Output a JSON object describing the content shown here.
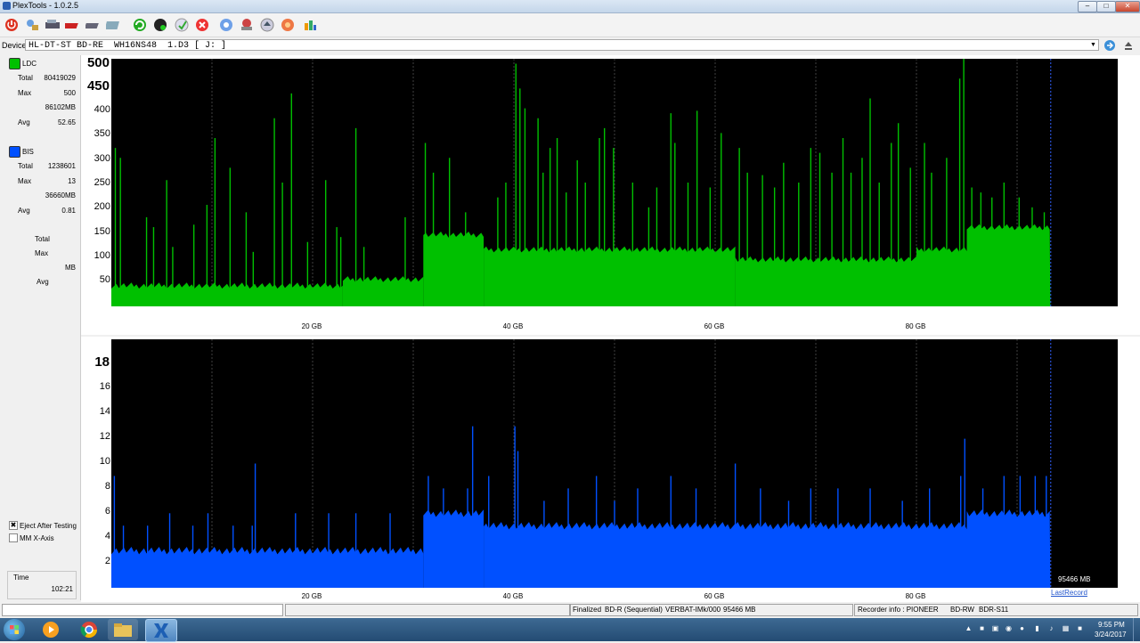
{
  "window": {
    "title": "PlexTools - 1.0.2.5"
  },
  "toolbar": {
    "icons": [
      "power-icon",
      "drive-info-icon",
      "drive-config-icon",
      "disc-write-icon",
      "disc-read-icon",
      "media-info-icon",
      "refresh-icon",
      "disc-quality-icon",
      "clean-icon",
      "stop-icon",
      "q-check-icon",
      "disc-copy-icon",
      "eject-icon",
      "settings-icon",
      "about-icon"
    ]
  },
  "device": {
    "label": "Device:",
    "value": "HL-DT-ST BD-RE  WH16NS48  1.D3 [ J: ]"
  },
  "left_panel": {
    "ldc": {
      "name": "LDC",
      "color": "#00c000",
      "total_label": "Total",
      "total": "80419029",
      "max_label": "Max",
      "max": "500",
      "max_pos": "86102MB",
      "avg_label": "Avg",
      "avg": "52.65"
    },
    "bis": {
      "name": "BIS",
      "color": "#0050ff",
      "total_label": "Total",
      "total": "1238601",
      "max_label": "Max",
      "max": "13",
      "max_pos": "36660MB",
      "avg_label": "Avg",
      "avg": "0.81"
    },
    "third": {
      "total_label": "Total",
      "max_label": "Max",
      "mb_label": "MB",
      "avg_label": "Avg"
    },
    "eject_after_testing": {
      "label": "Eject After Testing",
      "checked": true
    },
    "mm_x_axis": {
      "label": "MM X-Axis",
      "checked": false
    },
    "time": {
      "label": "Time",
      "value": "102:21"
    }
  },
  "chart_data": [
    {
      "type": "area",
      "series": [
        {
          "name": "LDC",
          "color": "#00c000"
        }
      ],
      "x_unit": "GB",
      "xlim": [
        0,
        100
      ],
      "data_end_gb": 93.3,
      "ylim": [
        0,
        500
      ],
      "y_ticks": [
        "500",
        "450",
        "400",
        "350",
        "300",
        "250",
        "200",
        "150",
        "100",
        "50"
      ],
      "x_ticks": [
        "20 GB",
        "40 GB",
        "60 GB",
        "80 GB"
      ],
      "baseline_segments": [
        {
          "from": 0,
          "to": 23,
          "level": 42
        },
        {
          "from": 23,
          "to": 31,
          "level": 55
        },
        {
          "from": 31,
          "to": 37,
          "level": 145
        },
        {
          "from": 37,
          "to": 62,
          "level": 115
        },
        {
          "from": 62,
          "to": 80,
          "level": 95
        },
        {
          "from": 80,
          "to": 85,
          "level": 115
        },
        {
          "from": 85,
          "to": 93.3,
          "level": 160
        }
      ],
      "spikes": [
        {
          "x": 0.4,
          "v": 320
        },
        {
          "x": 0.9,
          "v": 300
        },
        {
          "x": 3.5,
          "v": 180
        },
        {
          "x": 4.2,
          "v": 160
        },
        {
          "x": 5.5,
          "v": 255
        },
        {
          "x": 6.1,
          "v": 120
        },
        {
          "x": 8.2,
          "v": 165
        },
        {
          "x": 9.5,
          "v": 205
        },
        {
          "x": 10.3,
          "v": 340
        },
        {
          "x": 11.8,
          "v": 280
        },
        {
          "x": 13.4,
          "v": 190
        },
        {
          "x": 14.1,
          "v": 110
        },
        {
          "x": 16.2,
          "v": 380
        },
        {
          "x": 17.0,
          "v": 250
        },
        {
          "x": 17.9,
          "v": 430
        },
        {
          "x": 19.5,
          "v": 130
        },
        {
          "x": 21.3,
          "v": 255
        },
        {
          "x": 22.4,
          "v": 160
        },
        {
          "x": 22.8,
          "v": 140
        },
        {
          "x": 24.3,
          "v": 360
        },
        {
          "x": 25.1,
          "v": 120
        },
        {
          "x": 29.2,
          "v": 180
        },
        {
          "x": 31.2,
          "v": 330
        },
        {
          "x": 32.0,
          "v": 270
        },
        {
          "x": 33.6,
          "v": 300
        },
        {
          "x": 35.2,
          "v": 190
        },
        {
          "x": 38.4,
          "v": 220
        },
        {
          "x": 39.2,
          "v": 250
        },
        {
          "x": 40.2,
          "v": 490
        },
        {
          "x": 40.6,
          "v": 440
        },
        {
          "x": 41.1,
          "v": 400
        },
        {
          "x": 42.4,
          "v": 380
        },
        {
          "x": 42.9,
          "v": 270
        },
        {
          "x": 43.6,
          "v": 320
        },
        {
          "x": 44.3,
          "v": 340
        },
        {
          "x": 45.2,
          "v": 230
        },
        {
          "x": 46.3,
          "v": 295
        },
        {
          "x": 47.1,
          "v": 250
        },
        {
          "x": 48.5,
          "v": 340
        },
        {
          "x": 49.0,
          "v": 360
        },
        {
          "x": 49.9,
          "v": 320
        },
        {
          "x": 51.8,
          "v": 250
        },
        {
          "x": 53.4,
          "v": 200
        },
        {
          "x": 54.2,
          "v": 240
        },
        {
          "x": 55.6,
          "v": 390
        },
        {
          "x": 56.0,
          "v": 330
        },
        {
          "x": 57.3,
          "v": 250
        },
        {
          "x": 58.2,
          "v": 395
        },
        {
          "x": 59.5,
          "v": 240
        },
        {
          "x": 60.6,
          "v": 350
        },
        {
          "x": 62.4,
          "v": 320
        },
        {
          "x": 63.2,
          "v": 270
        },
        {
          "x": 64.7,
          "v": 265
        },
        {
          "x": 65.9,
          "v": 240
        },
        {
          "x": 66.8,
          "v": 290
        },
        {
          "x": 68.3,
          "v": 250
        },
        {
          "x": 69.5,
          "v": 320
        },
        {
          "x": 70.4,
          "v": 310
        },
        {
          "x": 71.6,
          "v": 270
        },
        {
          "x": 72.7,
          "v": 340
        },
        {
          "x": 73.5,
          "v": 270
        },
        {
          "x": 74.6,
          "v": 300
        },
        {
          "x": 75.4,
          "v": 420
        },
        {
          "x": 76.3,
          "v": 250
        },
        {
          "x": 77.5,
          "v": 330
        },
        {
          "x": 78.2,
          "v": 370
        },
        {
          "x": 79.4,
          "v": 280
        },
        {
          "x": 80.8,
          "v": 330
        },
        {
          "x": 81.5,
          "v": 270
        },
        {
          "x": 83.0,
          "v": 300
        },
        {
          "x": 84.3,
          "v": 460
        },
        {
          "x": 84.7,
          "v": 500
        },
        {
          "x": 85.5,
          "v": 240
        },
        {
          "x": 86.4,
          "v": 230
        },
        {
          "x": 87.5,
          "v": 220
        },
        {
          "x": 88.7,
          "v": 250
        },
        {
          "x": 90.2,
          "v": 220
        },
        {
          "x": 91.5,
          "v": 200
        },
        {
          "x": 92.7,
          "v": 190
        }
      ]
    },
    {
      "type": "bar",
      "series": [
        {
          "name": "BIS",
          "color": "#0050ff"
        }
      ],
      "x_unit": "GB",
      "xlim": [
        0,
        100
      ],
      "data_end_gb": 93.3,
      "ylim": [
        0,
        20
      ],
      "y_ticks": [
        "18",
        "16",
        "14",
        "12",
        "10",
        "8",
        "6",
        "4",
        "2"
      ],
      "x_ticks": [
        "20 GB",
        "40 GB",
        "60 GB",
        "80 GB"
      ],
      "baseline_segments": [
        {
          "from": 0,
          "to": 31,
          "level": 3
        },
        {
          "from": 31,
          "to": 37,
          "level": 6
        },
        {
          "from": 37,
          "to": 62,
          "level": 5
        },
        {
          "from": 62,
          "to": 85,
          "level": 5
        },
        {
          "from": 85,
          "to": 93.3,
          "level": 6
        }
      ],
      "spikes": [
        {
          "x": 0.3,
          "v": 9
        },
        {
          "x": 1.2,
          "v": 5
        },
        {
          "x": 3.6,
          "v": 5
        },
        {
          "x": 5.8,
          "v": 6
        },
        {
          "x": 8.1,
          "v": 5
        },
        {
          "x": 9.6,
          "v": 6
        },
        {
          "x": 12.1,
          "v": 5
        },
        {
          "x": 14.0,
          "v": 5
        },
        {
          "x": 14.3,
          "v": 10
        },
        {
          "x": 18.3,
          "v": 6
        },
        {
          "x": 21.6,
          "v": 6
        },
        {
          "x": 24.3,
          "v": 6
        },
        {
          "x": 27.7,
          "v": 6
        },
        {
          "x": 31.5,
          "v": 9
        },
        {
          "x": 33.0,
          "v": 8
        },
        {
          "x": 35.4,
          "v": 8
        },
        {
          "x": 35.9,
          "v": 13
        },
        {
          "x": 37.5,
          "v": 9
        },
        {
          "x": 40.1,
          "v": 13
        },
        {
          "x": 40.4,
          "v": 11
        },
        {
          "x": 43.0,
          "v": 7
        },
        {
          "x": 45.4,
          "v": 8
        },
        {
          "x": 48.2,
          "v": 9
        },
        {
          "x": 50.0,
          "v": 7
        },
        {
          "x": 52.3,
          "v": 8
        },
        {
          "x": 55.6,
          "v": 9
        },
        {
          "x": 58.1,
          "v": 8
        },
        {
          "x": 62.0,
          "v": 10
        },
        {
          "x": 64.5,
          "v": 8
        },
        {
          "x": 67.3,
          "v": 7
        },
        {
          "x": 69.5,
          "v": 8
        },
        {
          "x": 72.2,
          "v": 8
        },
        {
          "x": 75.4,
          "v": 8
        },
        {
          "x": 78.6,
          "v": 7
        },
        {
          "x": 81.3,
          "v": 8
        },
        {
          "x": 84.4,
          "v": 9
        },
        {
          "x": 84.8,
          "v": 12
        },
        {
          "x": 86.6,
          "v": 8
        },
        {
          "x": 88.7,
          "v": 9
        },
        {
          "x": 90.3,
          "v": 9
        },
        {
          "x": 91.8,
          "v": 9
        },
        {
          "x": 92.9,
          "v": 9
        }
      ]
    }
  ],
  "chart_labels": {
    "end_value": "95466 MB",
    "last_record": "LastRecord"
  },
  "status": {
    "finalized": "Finalized",
    "media_type": "BD-R (Sequential)",
    "media_id": "VERBAT-IMk/000",
    "capacity": "95466 MB",
    "recorder_label": "Recorder info : PIONEER",
    "recorder_type": "BD-RW",
    "recorder_model": "BDR-S11"
  },
  "taskbar": {
    "apps": [
      "windows-media-player-icon",
      "chrome-icon",
      "file-explorer-icon",
      "plextools-icon"
    ],
    "clock_time": "9:55 PM",
    "clock_date": "3/24/2017"
  }
}
